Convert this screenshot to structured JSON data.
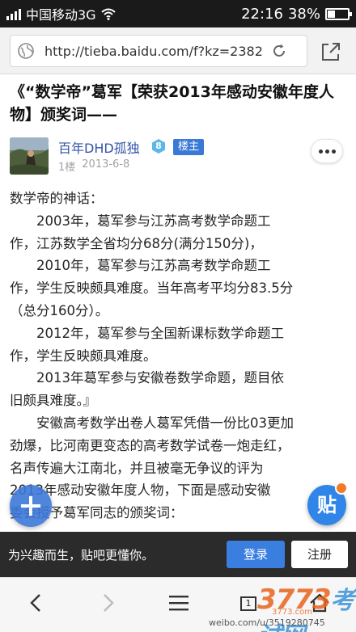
{
  "status_bar": {
    "carrier": "中国移动3G",
    "time": "22:16",
    "battery": "38%",
    "battery_level": 0.38
  },
  "address_bar": {
    "url": "http://tieba.baidu.com/f?kz=2382..."
  },
  "post": {
    "title_lines": [
      "《“数学帝”葛军【荣获2013年感动安徽年度人",
      "物】颁奖词——"
    ],
    "author": "百年DHD孤独",
    "level": "8",
    "owner_badge": "楼主",
    "floor": "1楼",
    "date": "2013-6-8",
    "body_lines": [
      "数学帝的神话：",
      "　　2003年，葛军参与江苏高考数学命题工",
      "作，江苏数学全省均分68分(满分150分)，",
      "　　2010年，葛军参与江苏高考数学命题工",
      "作，学生反映颇具难度。当年高考平均分83.5分",
      "（总分160分）。",
      "　　2012年，葛军参与全国新课标数学命题工",
      "作，学生反映颇具难度。",
      "　　2013年葛军参与安徽卷数学命题，题目依",
      "旧颇具难度。』",
      "　　安徽高考数学出卷人葛军凭借一份比03更加",
      "劲爆，比河南更变态的高考数学试卷一炮走红，",
      "名声传遍大江南北，并且被毫无争议的评为",
      "2013年感动安徽年度人物，下面是感动安徽",
      "委会授予葛军同志的颁奖词："
    ]
  },
  "floating": {
    "post_button_icon": "plus-icon",
    "tie_button_label": "贴"
  },
  "login_bar": {
    "slogan": "为兴趣而生，贴吧更懂你。",
    "login_label": "登录",
    "register_label": "注册"
  },
  "navbar": {
    "tab_count": "1"
  },
  "watermark": {
    "logo_main": "3773",
    "logo_cn": "考试网",
    "sub": "3773.com",
    "weibo": "weibo.com/u/3519280745"
  },
  "colors": {
    "accent_blue": "#3a7fe0",
    "author_link": "#3355aa",
    "status_bg": "#1a1a1a",
    "watermark_orange": "#e8641e"
  }
}
